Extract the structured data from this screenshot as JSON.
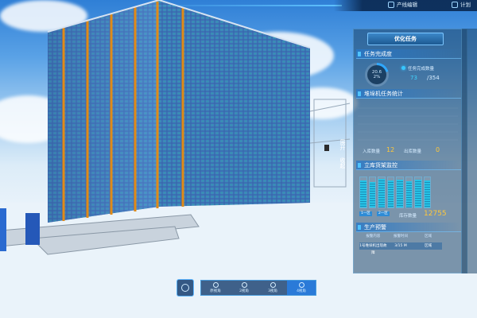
{
  "top_bar": {
    "line_edit_label": "产线编辑",
    "plan_label": "计划"
  },
  "panel": {
    "title": "优化任务",
    "task_completion": {
      "header": "任务完成度",
      "percent_line1": "20.6",
      "percent_line2": "2%",
      "progress_fraction": 0.206,
      "count_label": "任务完成数量",
      "completed": "73",
      "total": "/354"
    },
    "stacker_stats": {
      "header": "堆垛机任务统计",
      "inbound_label": "入库数量",
      "inbound_value": "12",
      "outbound_label": "出库数量",
      "outbound_value": "0"
    },
    "shelf_monitor": {
      "header": "立库货架监控",
      "tag_left": "1一区",
      "tag_right": "2一区",
      "stock_label": "库存数量",
      "stock_value": "12755",
      "bar_levels": [
        0.9,
        0.85,
        0.95,
        0.9,
        0.92,
        0.88,
        0.93,
        0.9
      ]
    },
    "production_alert": {
      "header": "生产预警",
      "columns": [
        "报警内容",
        "报警时间",
        "区域"
      ],
      "rows": [
        [
          "1号堆垛机出现故障",
          "3/15 M",
          "区域"
        ]
      ]
    },
    "expand_label": "展开",
    "collapse_label": "收起"
  },
  "bottom_bar": {
    "views": [
      {
        "label": "原视角",
        "active": false
      },
      {
        "label": "2视角",
        "active": false
      },
      {
        "label": "3视角",
        "active": false
      },
      {
        "label": "4视角",
        "active": true
      }
    ]
  }
}
